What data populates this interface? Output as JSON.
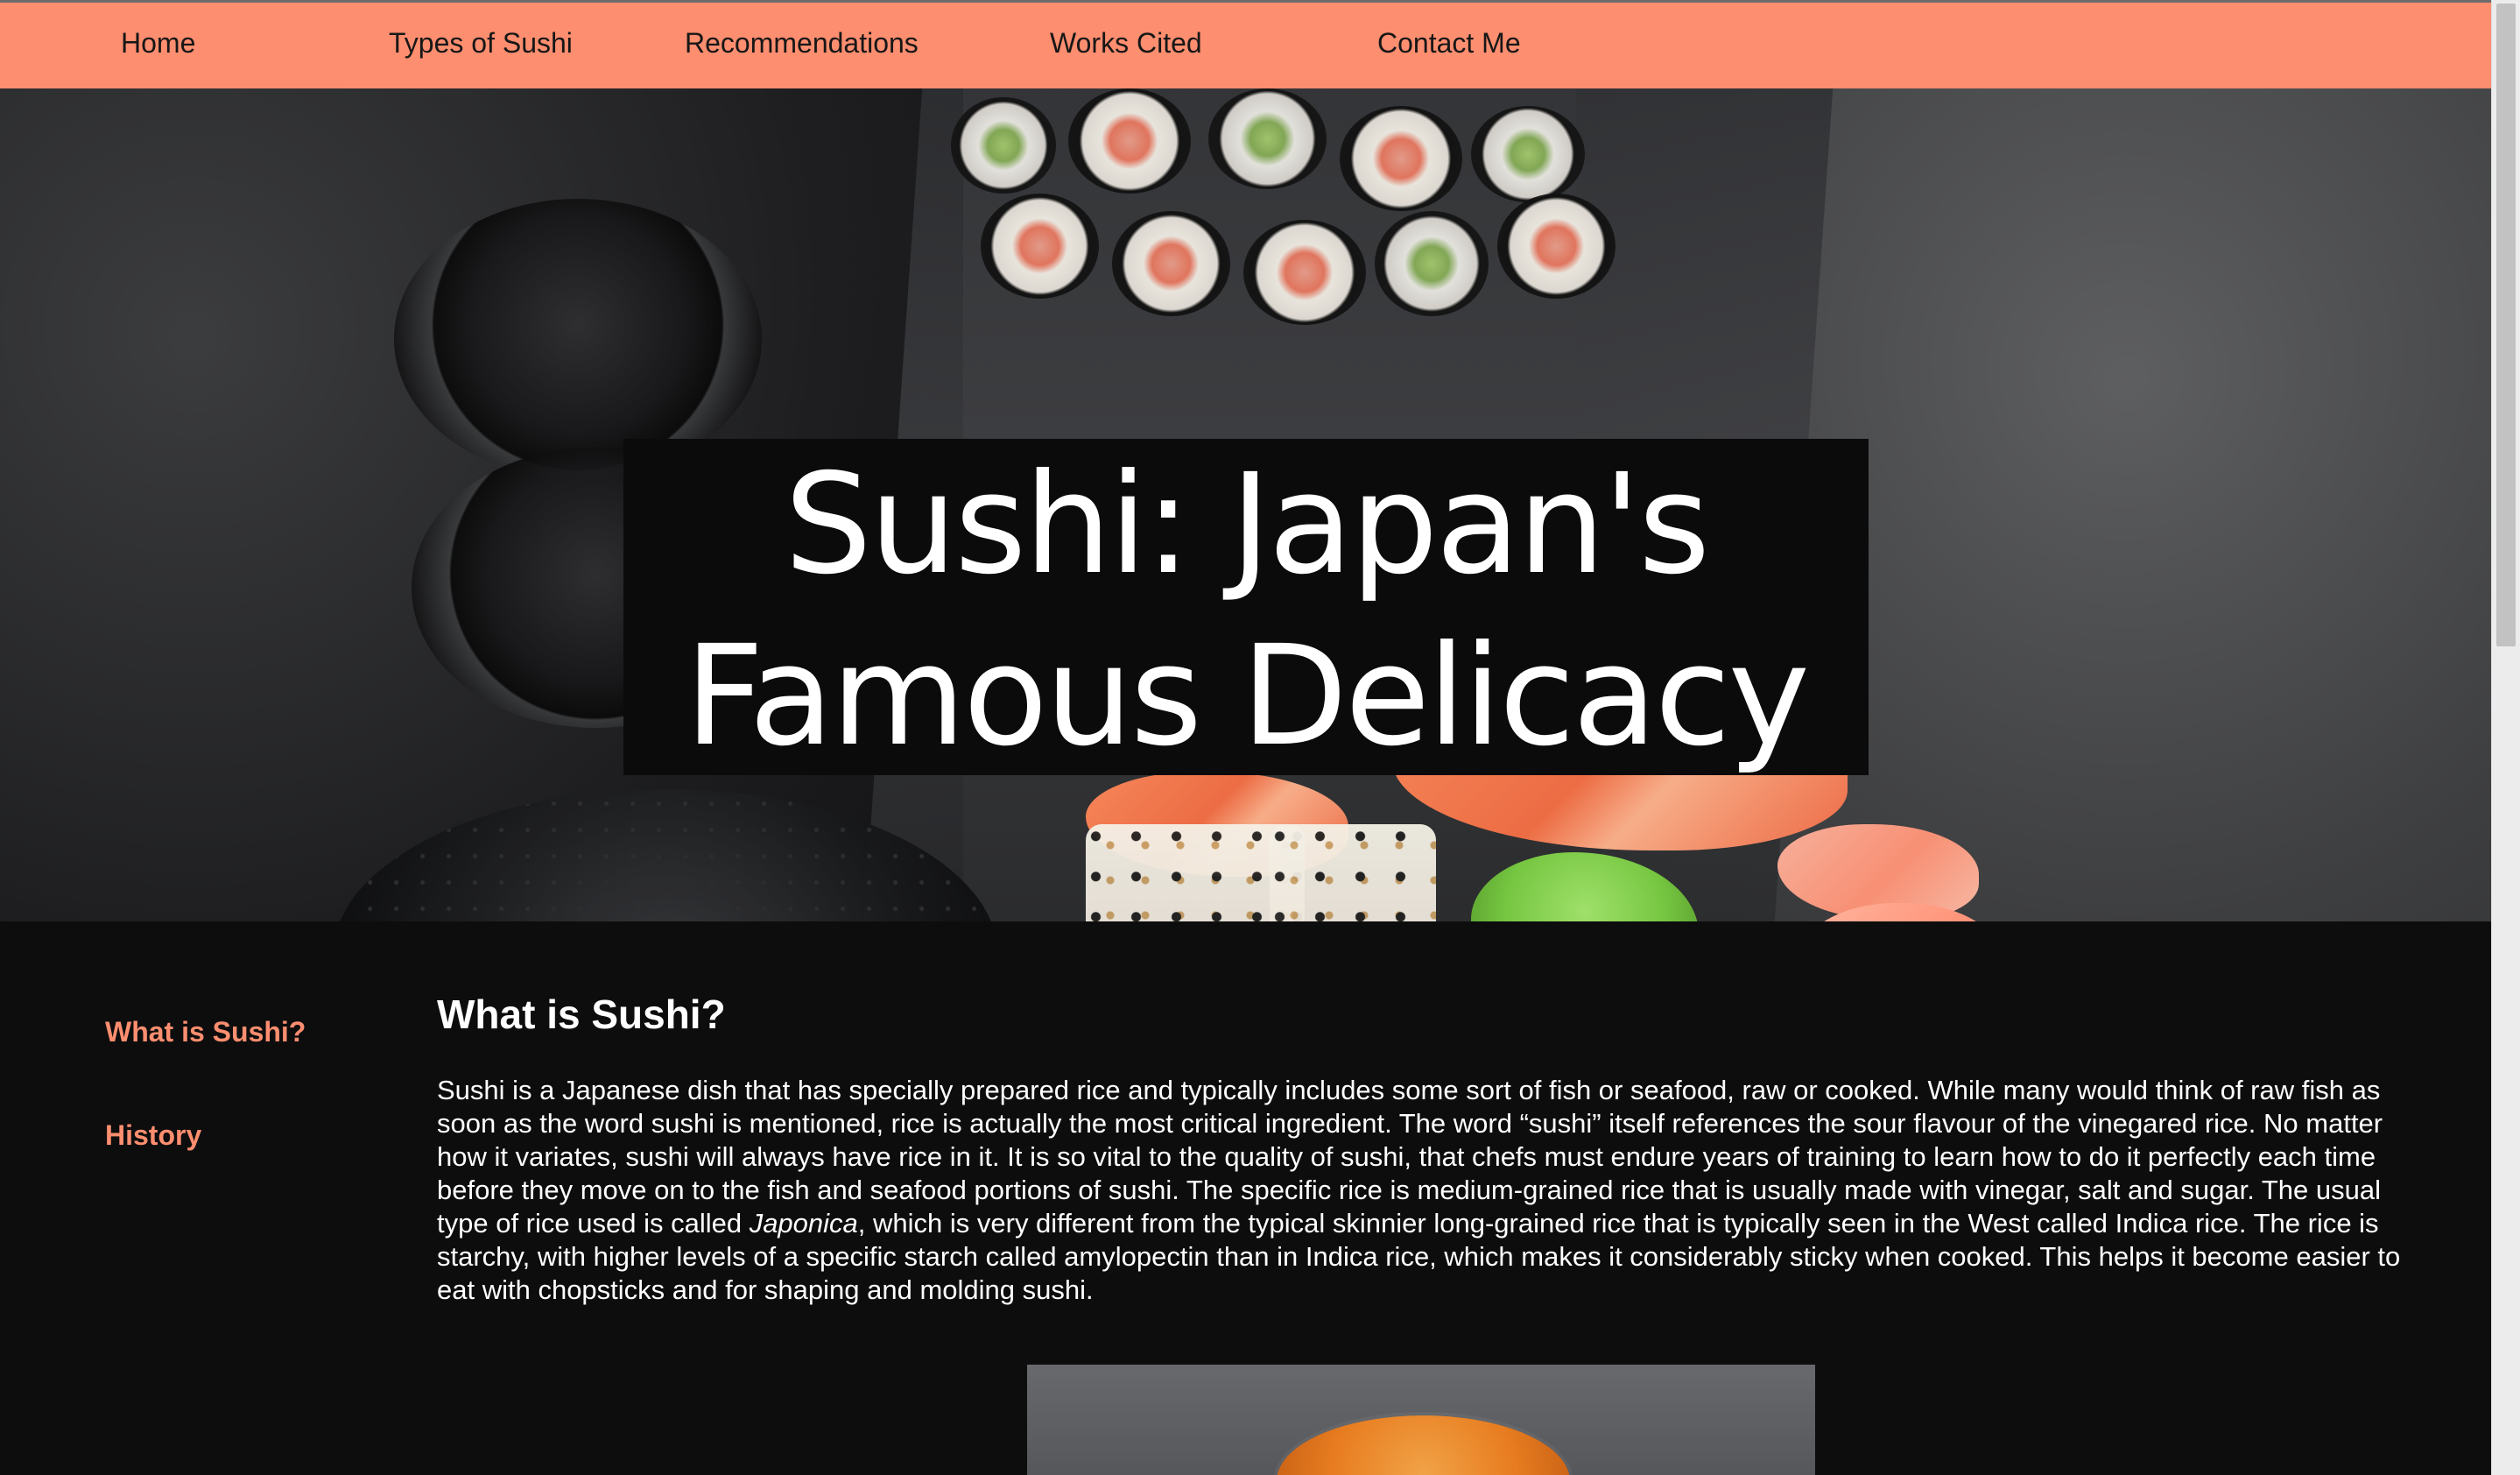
{
  "nav": {
    "items": [
      {
        "label": "Home"
      },
      {
        "label": "Types of Sushi"
      },
      {
        "label": "Recommendations"
      },
      {
        "label": "Works Cited"
      },
      {
        "label": "Contact Me"
      }
    ]
  },
  "hero": {
    "title": "Sushi: Japan's\nFamous Delicacy"
  },
  "sidebar": {
    "items": [
      {
        "label": "What is Sushi?"
      },
      {
        "label": "History"
      }
    ]
  },
  "main": {
    "section_title": "What is Sushi?",
    "paragraph_parts": [
      "Sushi is a Japanese dish that has specially prepared rice and typically includes some sort of fish or seafood, raw or cooked. While many would think of raw fish as soon as the word sushi is mentioned, rice is actually the most critical ingredient. The word “sushi” itself references the sour flavour of the vinegared rice. No matter how it variates, sushi will always have rice in it. It is so vital to the quality of sushi, that chefs must endure years of training to learn how to do it perfectly each time before they move on to the fish and seafood portions of sushi. The specific rice is medium-grained rice that is usually made with vinegar, salt and sugar. The usual type of rice used is called ",
      "Japonica",
      ", which is very different from the typical skinnier long-grained rice that is typically seen in the West called Indica rice. The rice is starchy, with higher levels of a specific starch called amylopectin than in Indica rice, which makes it considerably sticky when cooked. This helps it become easier to eat with chopsticks and for shaping and molding sushi."
    ]
  },
  "colors": {
    "accent": "#fd8e6f",
    "background": "#0d0d0e",
    "navbar": "#fd8e6f",
    "text": "#ffffff"
  }
}
